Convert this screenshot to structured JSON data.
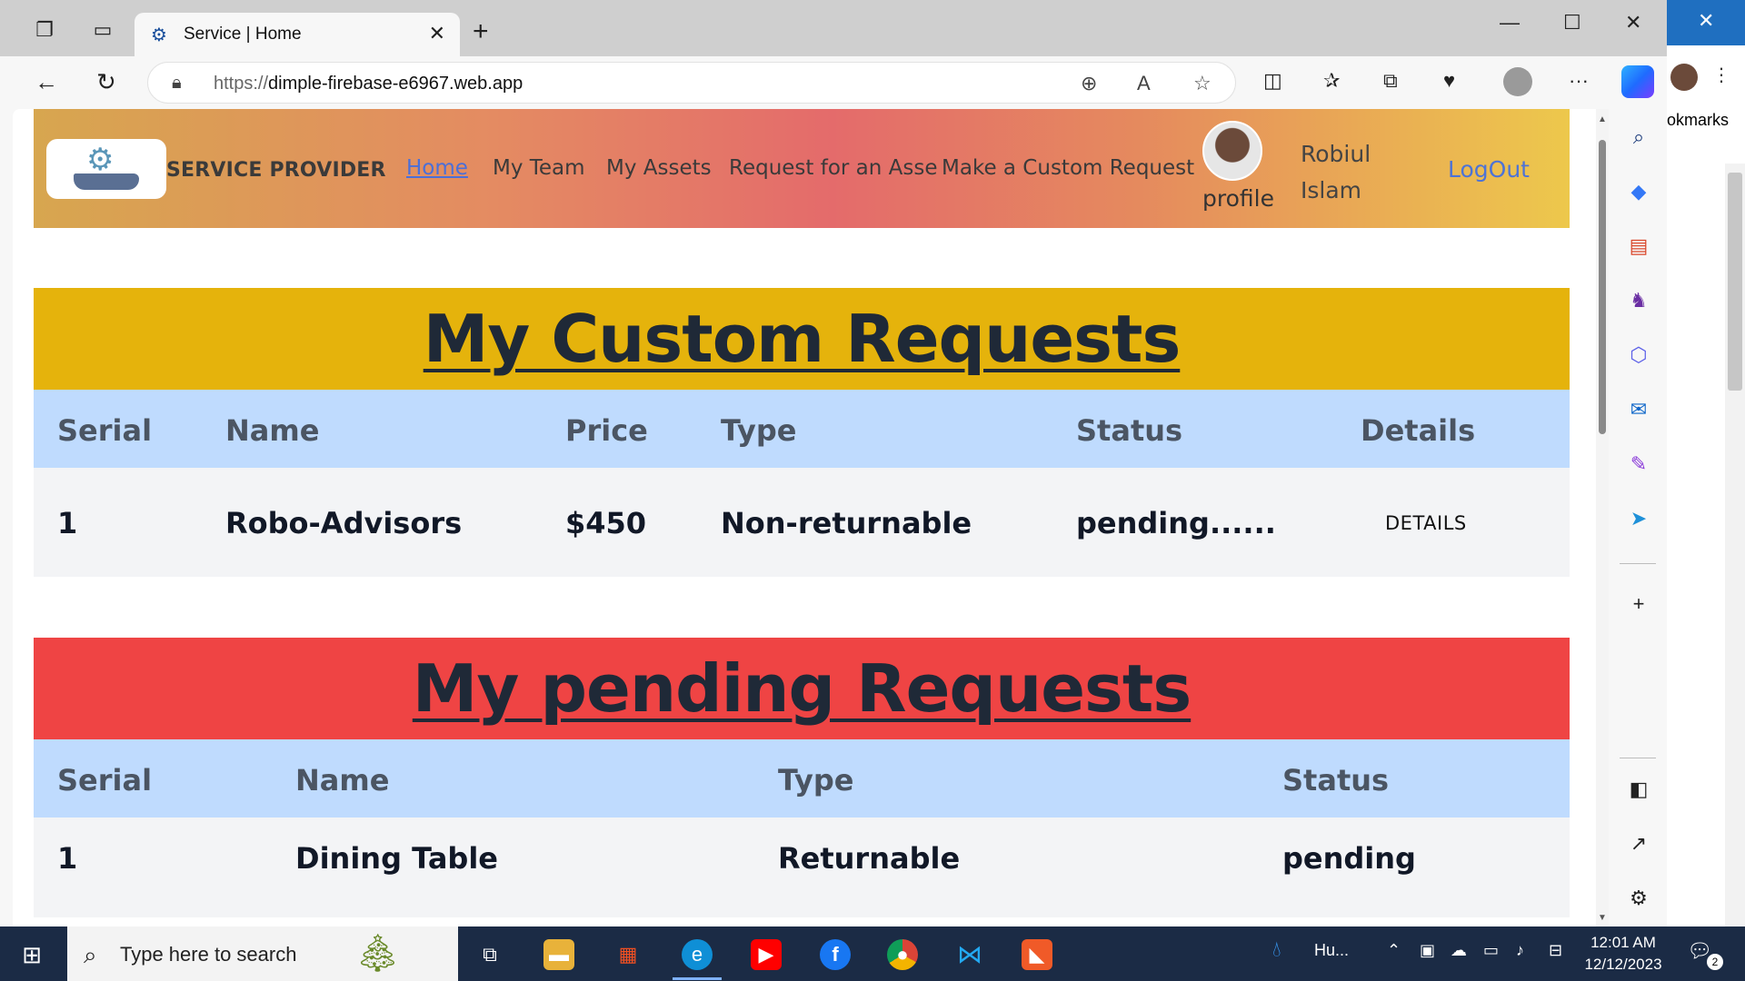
{
  "browser": {
    "tab_title": "Service | Home",
    "url_protocol": "https://",
    "url_host": "dimple-firebase-e6967.web.app",
    "behind_window_text": "okmarks"
  },
  "site": {
    "brand": "SERVICE PROVIDER",
    "nav": [
      {
        "label": "Home",
        "active": true
      },
      {
        "label": "My Team"
      },
      {
        "label": "My Assets"
      },
      {
        "label": "Request for an Asse"
      },
      {
        "label": "Make a Custom Request"
      }
    ],
    "profile_label": "profile",
    "user_name": "Robiul Islam",
    "logout": "LogOut",
    "custom_requests": {
      "title": "My Custom Requests",
      "columns": [
        "Serial",
        "Name",
        "Price",
        "Type",
        "Status",
        "Details"
      ],
      "rows": [
        {
          "serial": "1",
          "name": "Robo-Advisors",
          "price": "$450",
          "type": "Non-returnable",
          "status": "pending......",
          "details": "DETAILS"
        }
      ]
    },
    "pending_requests": {
      "title": "My pending Requests",
      "columns": [
        "Serial",
        "Name",
        "Type",
        "Status"
      ],
      "rows": [
        {
          "serial": "1",
          "name": "Dining Table",
          "type": "Returnable",
          "status": "pending"
        }
      ]
    }
  },
  "taskbar": {
    "search_placeholder": "Type here to search",
    "weather_label": "Hu...",
    "time": "12:01 AM",
    "date": "12/12/2023",
    "notification_count": "2"
  },
  "colors": {
    "custom_header_bg": "#e5b30c",
    "pending_header_bg": "#ef4444",
    "table_head_bg": "#bfdbfe",
    "row_bg": "#f3f4f6"
  }
}
